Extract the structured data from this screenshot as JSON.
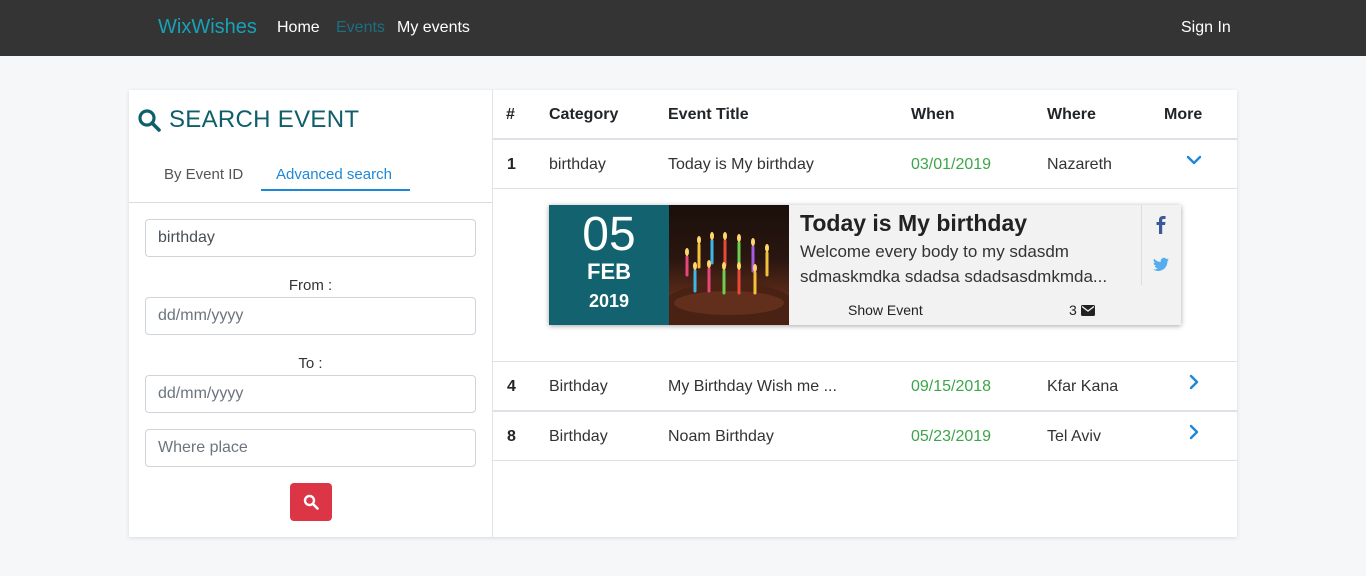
{
  "navbar": {
    "brand": "WixWishes",
    "links": [
      "Home",
      "Events",
      "My events"
    ],
    "sign_in": "Sign In"
  },
  "search": {
    "title": "SEARCH EVENT",
    "tabs": [
      "By Event ID",
      "Advanced search"
    ],
    "active_tab": "Advanced search",
    "keyword_value": "birthday",
    "from_label": "From :",
    "from_placeholder": "dd/mm/yyyy",
    "to_label": "To :",
    "to_placeholder": "dd/mm/yyyy",
    "place_placeholder": "Where place",
    "button_icon": "search-icon"
  },
  "table": {
    "headers": [
      "#",
      "Category",
      "Event Title",
      "When",
      "Where",
      "More"
    ],
    "rows": [
      {
        "num": "1",
        "category": "birthday",
        "title": "Today is My birthday",
        "when": "03/01/2019",
        "where": "Nazareth",
        "expanded": true
      },
      {
        "num": "4",
        "category": "Birthday",
        "title": "My Birthday Wish me ...",
        "when": "09/15/2018",
        "where": "Kfar Kana",
        "expanded": false
      },
      {
        "num": "8",
        "category": "Birthday",
        "title": "Noam Birthday",
        "when": "05/23/2019",
        "where": "Tel Aviv",
        "expanded": false
      }
    ]
  },
  "event_card": {
    "day": "05",
    "month": "FEB",
    "year": "2019",
    "title": "Today is My birthday",
    "desc_line1": "Welcome every body to my sdasdm",
    "desc_line2": "sdmaskmdka sdadsa sdadsasdmkmda...",
    "show_event": "Show Event",
    "count": "3",
    "accent": "#12636f"
  },
  "colors": {
    "navbar": "#343434",
    "brand": "#17a2b8",
    "tab_active": "#1e88d8",
    "date_green": "#3ca54a",
    "button_red": "#dc3545",
    "chevron_blue": "#1e88d8"
  }
}
